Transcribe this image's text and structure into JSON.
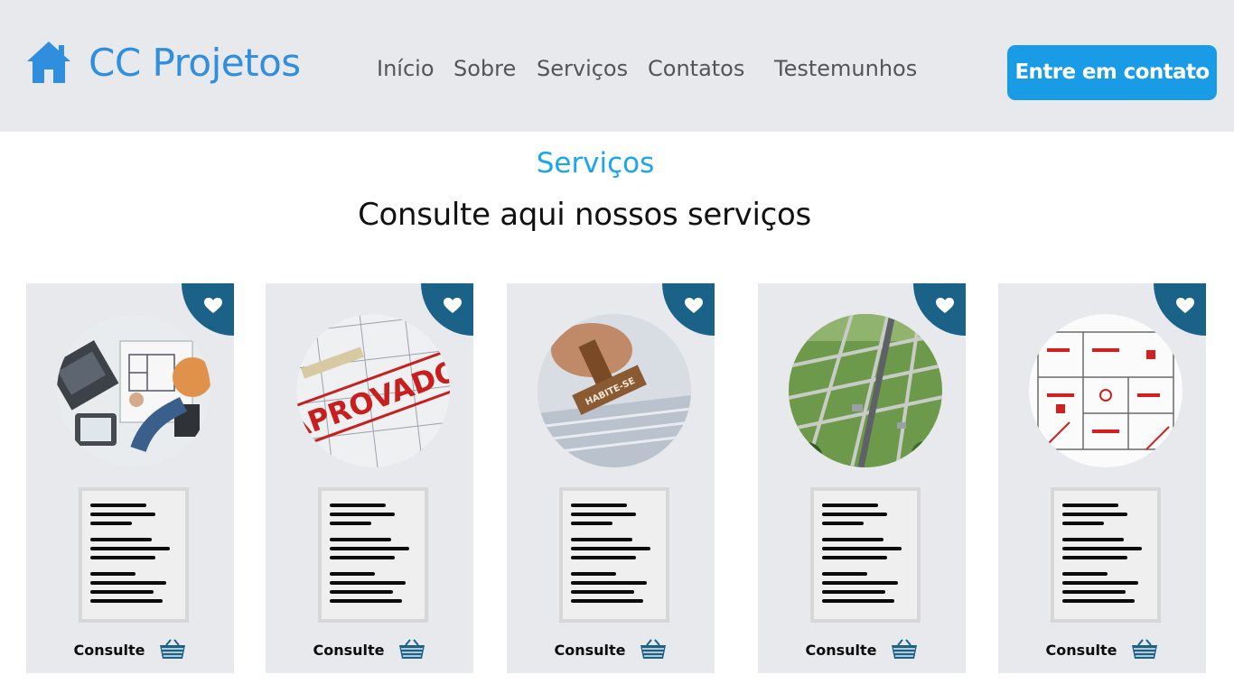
{
  "header": {
    "brand": "CC Projetos",
    "nav": [
      "Início",
      "Sobre",
      "Serviços",
      "Contatos",
      "Testemunhos"
    ],
    "cta_label": "Entre em contato"
  },
  "section": {
    "label": "Serviços",
    "title": "Consulte aqui nossos serviços"
  },
  "cards": [
    {
      "consult_label": "Consulte",
      "photo_icon": "architect-desk-photo"
    },
    {
      "consult_label": "Consulte",
      "photo_icon": "approved-stamp-photo",
      "photo_text": "APROVADO"
    },
    {
      "consult_label": "Consulte",
      "photo_icon": "habite-se-stamp-photo",
      "photo_text": "HABITE-SE"
    },
    {
      "consult_label": "Consulte",
      "photo_icon": "land-subdivision-photo"
    },
    {
      "consult_label": "Consulte",
      "photo_icon": "fire-safety-plan-photo"
    }
  ],
  "colors": {
    "header_bg": "#e8e9ed",
    "brand": "#2f8fde",
    "cta": "#1a9be6",
    "section_label": "#1aa5ef",
    "ribbon": "#1b6289",
    "card_bg": "#e8e9ed"
  }
}
